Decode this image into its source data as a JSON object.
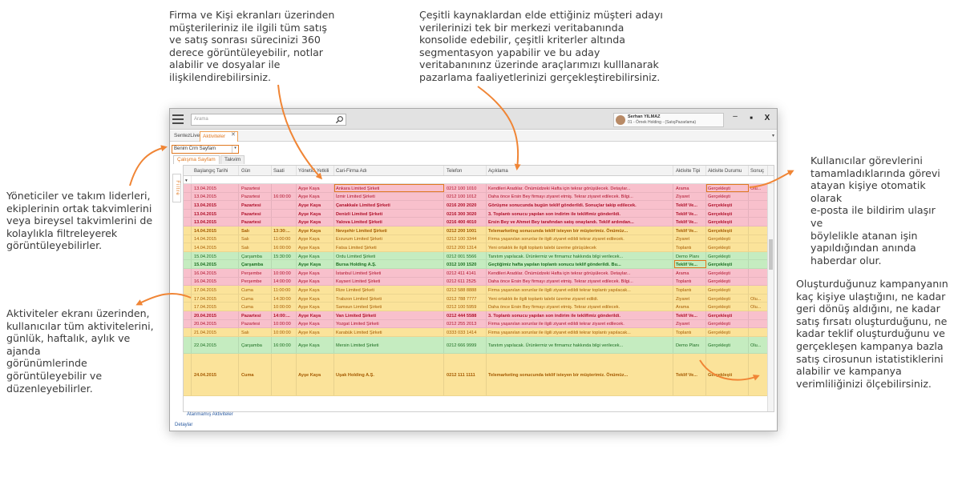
{
  "callouts": {
    "top_left": "Firma ve Kişi ekranları üzerinden\nmüşterileriniz ile ilgili tüm satış\nve satış sonrası sürecinizi 360\nderece görüntüleyebilir, notlar\nalabilir ve dosyalar ile\nilişkilendirebilirsiniz.",
    "top_right": "Çeşitli kaynaklardan elde ettiğiniz müşteri adayı\nverilerinizi tek bir merkezi veritabanında\nkonsolide edebilir, çeşitli kriterler altında\nsegmentasyon yapabilir ve bu aday\nveritabanınınz üzerinde araçlarımızı kulllanarak\npazarlama faaliyetlerinizi gerçekleştirebilirsiniz.",
    "left_top": "Yöneticiler ve takım liderleri,\nekiplerinin ortak takvimlerini\nveya bireysel takvimlerini de\nkolaylıkla filtreleyerek\ngörüntüleyebilirler.",
    "left_bottom": "Aktiviteler ekranı üzerinden,\nkullanıcılar tüm aktivitelerini,\ngünlük, haftalık, aylık ve ajanda\ngörünümlerinde\ngörüntüleyebilir ve\ndüzenleyebilirler.",
    "right_top": "Kullanıcılar görevlerini\ntamamladıklarında görevi\natayan kişiye otomatik olarak\ne-posta ile bildirim ulaşır ve\nböylelikle atanan işin\nyapıldığından anında\nhaberdar olur.",
    "right_bottom": "Oluşturduğunuz kampanyanın\nkaç kişiye ulaştığını, ne kadar\ngeri dönüş aldığını, ne kadar\nsatış fırsatı oluşturduğunu, ne\nkadar teklif oluşturduğunu ve\ngerçekleşen kampanya bazla\nsatış cirosunun istatistiklerini\nalabilir ve kampanya\nverimliliğinizi ölçebilirsiniz."
  },
  "app": {
    "search_placeholder": "Arama",
    "user_name": "Serhan YILMAZ",
    "user_company": "01 - Örnek Holding - (SatışPazarlama)",
    "window_controls": {
      "minimize": "–",
      "maximize": "■",
      "close": "X"
    },
    "doc_tabs": [
      "SentezLive",
      "Aktiviteler"
    ],
    "tab_close": "✕",
    "view_selector": "Benim Crm Sayfam",
    "sub_tabs": [
      "Çalışma Sayfam",
      "Takvim"
    ],
    "filter_label": "Filtre",
    "footer_link": "Atanmamış Aktiviteler",
    "details_link": "Detaylar"
  },
  "grid": {
    "columns": [
      "Başlangıç Tarihi",
      "Gün",
      "Saati",
      "Yönetici Yetkili",
      "Cari-Firma Adı",
      "Telefon",
      "Açıklama",
      "Aktivite Tipi",
      "Aktivite Durumu",
      "Sonuç"
    ],
    "rows": [
      {
        "date": "13.04.2015",
        "day": "Pazartesi",
        "time": "",
        "manager": "Ayşe Kaya",
        "company": "Ankara Limited Şirketi",
        "phone": "0212 100 1010",
        "desc": "Kendileri Aradılar. Önümüdzeki Hafta için tekrar görüşülecek. Detaylar...",
        "type": "Arama",
        "status": "Gerçekleşti",
        "result": "Olu...",
        "color": "pink",
        "bold": false,
        "height": "normal"
      },
      {
        "date": "13.04.2015",
        "day": "Pazartesi",
        "time": "16:00:00",
        "manager": "Ayşe Kaya",
        "company": "İzmir Limited Şirketi",
        "phone": "0212 100 1012",
        "desc": "Daha önce Ersin Bey firmayı ziyaret etmiş. Tekrar ziyaret edilecek. Bilgi...",
        "type": "Ziyaret",
        "status": "Gerçekleşti",
        "result": "",
        "color": "pink",
        "bold": false,
        "height": "normal"
      },
      {
        "date": "13.04.2015",
        "day": "Pazartesi",
        "time": "",
        "manager": "Ayşe Kaya",
        "company": "Çanakkale Limited Şirketi",
        "phone": "0216 200 2020",
        "desc": "Görüşme sonucunda bugün teklif gönderildi. Sonuçlar takip edilecek.",
        "type": "Teklif Ve...",
        "status": "Gerçekleşti",
        "result": "",
        "color": "pink",
        "bold": true,
        "height": "normal"
      },
      {
        "date": "13.04.2015",
        "day": "Pazartesi",
        "time": "",
        "manager": "Ayşe Kaya",
        "company": "Denizli Limited Şirketi",
        "phone": "0216 300 3020",
        "desc": "3. Toplantı sonucu yapılan son indirim ile teklifimiz gönderildi.",
        "type": "Teklif Ve...",
        "status": "Gerçekleşti",
        "result": "",
        "color": "pink",
        "bold": true,
        "height": "normal"
      },
      {
        "date": "13.04.2015",
        "day": "Pazartesi",
        "time": "",
        "manager": "Ayşe Kaya",
        "company": "Yalova Limited Şirketi",
        "phone": "0216 400 4010",
        "desc": "Ersin Bey ve  Ahmet Bey tarafından satış onaylandı. Teklif ardından...",
        "type": "Teklif Ve...",
        "status": "Gerçekleşti",
        "result": "",
        "color": "pink",
        "bold": true,
        "height": "normal"
      },
      {
        "date": "14.04.2015",
        "day": "Salı",
        "time": "13:30:...",
        "manager": "Ayşe Kaya",
        "company": "Nevşehir Limited Şirketi",
        "phone": "0212 200 1001",
        "desc": "Telemarketing sonucunda teklif isteyen bir müşterimiz. Önümüz...",
        "type": "Teklif Ve...",
        "status": "Gerçekleşti",
        "result": "",
        "color": "yellow",
        "bold": true,
        "height": "normal"
      },
      {
        "date": "14.04.2015",
        "day": "Salı",
        "time": "11:00:00",
        "manager": "Ayşe Kaya",
        "company": "Erzurum Limited Şirketi",
        "phone": "0212 100 3344",
        "desc": "Firma yaşanılan sorunlar ile ilgili ziyaret edildi tekrar ziyaret edilecek.",
        "type": "Ziyaret",
        "status": "Gerçekleşti",
        "result": "",
        "color": "yellow",
        "bold": false,
        "height": "normal"
      },
      {
        "date": "14.04.2015",
        "day": "Salı",
        "time": "16:00:00",
        "manager": "Ayşe Kaya",
        "company": "Fatsa Limited Şirketi",
        "phone": "0212 200 1314",
        "desc": "Yeni ortaklık ile ilgili toplantı talebi üzerine görüşülecek",
        "type": "Toplantı",
        "status": "Gerçekleşti",
        "result": "",
        "color": "yellow",
        "bold": false,
        "height": "normal"
      },
      {
        "date": "15.04.2015",
        "day": "Çarşamba",
        "time": "15:30:00",
        "manager": "Ayşe Kaya",
        "company": "Ordu Limited Şirketi",
        "phone": "0212 001 5566",
        "desc": "Tanıtım yapılacak. Ürünlermiz ve firmamız hakkında bilgi verilecek...",
        "type": "Demo Planı",
        "status": "Gerçekleşti",
        "result": "",
        "color": "green",
        "bold": false,
        "height": "normal"
      },
      {
        "date": "15.04.2015",
        "day": "Çarşamba",
        "time": "",
        "manager": "Ayşe Kaya",
        "company": "Bursa Holding A.Ş.",
        "phone": "0312 100 1520",
        "desc": "Geçtiğimiz hafta yapılan toplantı sonucu teklif gönderildi. Bu...",
        "type": "Teklif Ve...",
        "status": "Gerçekleşti",
        "result": "",
        "color": "green",
        "bold": true,
        "height": "normal"
      },
      {
        "date": "16.04.2015",
        "day": "Perşembe",
        "time": "10:00:00",
        "manager": "Ayşe Kaya",
        "company": "İstanbul Limited Şirketi",
        "phone": "0212 411 4141",
        "desc": "Kendileri Aradılar. Önümüdzeki Hafta için tekrar görüşülecek. Detaylar...",
        "type": "Arama",
        "status": "Gerçekleşti",
        "result": "",
        "color": "pink",
        "bold": false,
        "height": "normal"
      },
      {
        "date": "16.04.2015",
        "day": "Perşembe",
        "time": "14:00:00",
        "manager": "Ayşe Kaya",
        "company": "Kayseri Limited Şirketi",
        "phone": "0212 611 2525",
        "desc": "Daha önce Ersin Bey firmayı ziyaret etmiş. Tekrar ziyaret edilecek. Bilgi...",
        "type": "Toplantı",
        "status": "Gerçekleşti",
        "result": "",
        "color": "pink",
        "bold": false,
        "height": "normal"
      },
      {
        "date": "17.04.2015",
        "day": "Cuma",
        "time": "11:00:00",
        "manager": "Ayşe Kaya",
        "company": "Rize Limited Şirketi",
        "phone": "0212 588 8888",
        "desc": "Firma yaşanılan sorunlar ile ilgili ziyaret edildi tekrar toplantı yapılacak...",
        "type": "Toplantı",
        "status": "Gerçekleşti",
        "result": "",
        "color": "yellow",
        "bold": false,
        "height": "normal"
      },
      {
        "date": "17.04.2015",
        "day": "Cuma",
        "time": "14:30:00",
        "manager": "Ayşe Kaya",
        "company": "Trabzon Limited Şirketi",
        "phone": "0212 788 7777",
        "desc": "Yeni ortaklık ile ilgili toplantı talebi üzerine ziyaret edildi.",
        "type": "Ziyaret",
        "status": "Gerçekleşti",
        "result": "Olu...",
        "color": "yellow",
        "bold": false,
        "height": "normal"
      },
      {
        "date": "17.04.2015",
        "day": "Cuma",
        "time": "10:00:00",
        "manager": "Ayşe Kaya",
        "company": "Samsun Limited Şirketi",
        "phone": "0212 100 5959",
        "desc": "Daha önce Ersin Bey firmayı ziyaret etmiş. Tekrar ziyaret edilecek.",
        "type": "Arama",
        "status": "Gerçekleşti",
        "result": "Olu...",
        "color": "yellow",
        "bold": false,
        "height": "normal"
      },
      {
        "date": "20.04.2015",
        "day": "Pazartesi",
        "time": "14:00:...",
        "manager": "Ayşe Kaya",
        "company": "Van Limited Şirketi",
        "phone": "0212 444 5588",
        "desc": "3. Toplantı sonucu yapılan son indirim ile teklifimiz gönderildi.",
        "type": "Teklif Ve...",
        "status": "Gerçekleşti",
        "result": "",
        "color": "pink",
        "bold": true,
        "height": "normal"
      },
      {
        "date": "20.04.2015",
        "day": "Pazartesi",
        "time": "10:00:00",
        "manager": "Ayşe Kaya",
        "company": "Yozgat Limited Şirketi",
        "phone": "0212 255 2013",
        "desc": "Firma yaşanılan sorunlar ile ilgili ziyaret edildi tekrar ziyaret edilecek.",
        "type": "Ziyaret",
        "status": "Gerçekleşti",
        "result": "",
        "color": "pink",
        "bold": false,
        "height": "normal"
      },
      {
        "date": "21.04.2015",
        "day": "Salı",
        "time": "10:00:00",
        "manager": "Ayşe Kaya",
        "company": "Karabük Limited Şirketi",
        "phone": "0333 033 1414",
        "desc": "Firma yaşanılan sorunlar ile ilgili ziyaret edildi tekrar toplantı yapılacak...",
        "type": "Toplantı",
        "status": "Gerçekleşti",
        "result": "",
        "color": "yellow",
        "bold": false,
        "height": "normal"
      },
      {
        "date": "22.04.2015",
        "day": "Çarşamba",
        "time": "16:00:00",
        "manager": "Ayşe Kaya",
        "company": "Mersin Limited Şirketi",
        "phone": "0212 666 9999",
        "desc": "Tanıtım yapılacak. Ürünlermiz ve firmamız hakkında bilgi verilecek...",
        "type": "Demo Planı",
        "status": "Gerçekleşti",
        "result": "Olu...",
        "color": "green",
        "bold": false,
        "height": "tall1"
      },
      {
        "date": "24.04.2015",
        "day": "Cuma",
        "time": "",
        "manager": "Ayşe Kaya",
        "company": "Uşak Holding A.Ş.",
        "phone": "0212 111 1111",
        "desc": "Telemarketing sonucunda teklif isteyen bir müşterimiz. Önümüz...",
        "type": "Teklif Ve...",
        "status": "Gerçekleşti",
        "result": "",
        "color": "yellow",
        "bold": true,
        "height": "tall2"
      }
    ]
  },
  "colors": {
    "accent": "#e07820",
    "pink": "#f8c0cc",
    "yellow": "#fbe39a",
    "green": "#c5ecc0"
  }
}
